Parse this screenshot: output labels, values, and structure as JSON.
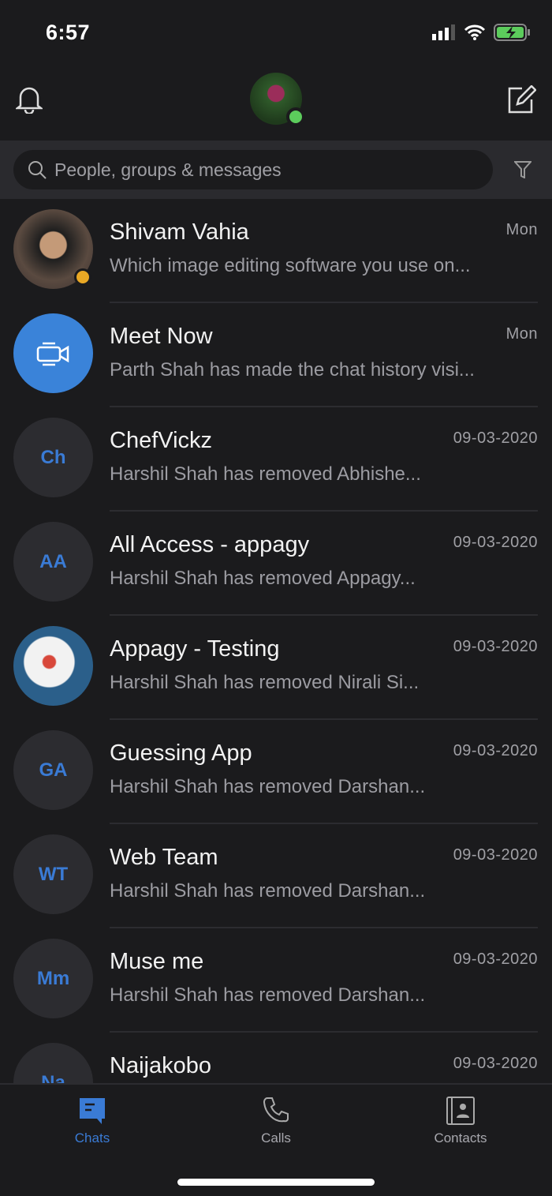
{
  "status_bar": {
    "time": "6:57"
  },
  "header": {
    "presence": "online"
  },
  "search": {
    "placeholder": "People, groups & messages"
  },
  "chats": [
    {
      "name": "Shivam Vahia",
      "message": "Which image editing software you use on...",
      "date": "Mon",
      "avatar": "photo"
    },
    {
      "name": "Meet Now",
      "message": "Parth Shah has made the chat history visi...",
      "date": "Mon",
      "avatar": "video-camera-icon"
    },
    {
      "name": "ChefVickz",
      "message": "Harshil Shah has removed Abhishe...",
      "date": "09-03-2020",
      "initials": "Ch"
    },
    {
      "name": "All Access - appagy",
      "message": "Harshil Shah has removed Appagy...",
      "date": "09-03-2020",
      "initials": "AA"
    },
    {
      "name": "Appagy - Testing",
      "message": "Harshil Shah has removed Nirali Si...",
      "date": "09-03-2020",
      "avatar": "photo"
    },
    {
      "name": "Guessing App",
      "message": "Harshil Shah has removed Darshan...",
      "date": "09-03-2020",
      "initials": "GA"
    },
    {
      "name": "Web Team",
      "message": "Harshil Shah has removed Darshan...",
      "date": "09-03-2020",
      "initials": "WT"
    },
    {
      "name": "Muse me",
      "message": "Harshil Shah has removed Darshan...",
      "date": "09-03-2020",
      "initials": "Mm"
    },
    {
      "name": "Naijakobo",
      "message": "",
      "date": "09-03-2020",
      "initials": "Na"
    }
  ],
  "tabs": [
    {
      "label": "Chats",
      "active": true
    },
    {
      "label": "Calls"
    },
    {
      "label": "Contacts"
    }
  ],
  "colors": {
    "accent": "#3a7bd5",
    "background": "#1b1b1d",
    "online": "#5ccc5c",
    "away": "#e9a825"
  }
}
